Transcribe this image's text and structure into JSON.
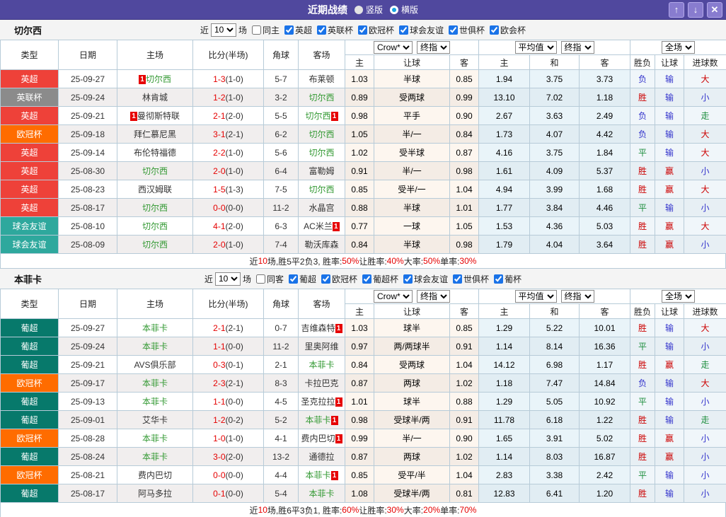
{
  "titlebar": {
    "title": "近期战绩",
    "radios": [
      {
        "label": "竖版",
        "selected": false
      },
      {
        "label": "横版",
        "selected": true
      }
    ],
    "buttons": {
      "up": "↑",
      "down": "↓",
      "close": "✕"
    }
  },
  "table_header": {
    "col_type": "类型",
    "col_date": "日期",
    "col_home": "主场",
    "col_score": "比分(半场)",
    "col_corner": "角球",
    "col_away": "客场",
    "dd_crow": "Crow*",
    "dd_final1": "终指",
    "dd_avg": "平均值",
    "dd_final2": "终指",
    "dd_full": "全场",
    "sub_crow": [
      "主",
      "让球",
      "客"
    ],
    "sub_avg": [
      "主",
      "和",
      "客"
    ],
    "sub_res": [
      "胜负",
      "让球",
      "进球数"
    ]
  },
  "colors": {
    "titlebar_bg": "#50489E",
    "titlebar_button_bg": "#887CCF",
    "checkbox_blue": "#1A73E8",
    "focus_team_green": "#339933",
    "score_red": "#E50000",
    "red_card": "#E60000"
  },
  "league_colors": {
    "英超": "#ee4139",
    "英联杯": "#8b8b8b",
    "欧冠杯": "#ff6c00",
    "球会友谊": "#2ea89d",
    "葡超": "#07796b"
  },
  "result_colors": {
    "胜": "#cc0000",
    "赢": "#cc0000",
    "大": "#cc0000",
    "平": "#1e8e3e",
    "走": "#1e8e3e",
    "负": "#3333cc",
    "输": "#3333cc",
    "小": "#3333cc"
  },
  "sections": [
    {
      "team": "切尔西",
      "filter": {
        "prefix": "近",
        "count": "10",
        "suffix": "场",
        "same": "同主",
        "leagues": [
          "英超",
          "英联杯",
          "欧冠杯",
          "球会友谊",
          "世俱杯",
          "欧会杯"
        ]
      },
      "rows": [
        {
          "league": "英超",
          "date": "25-09-27",
          "home": "切尔西",
          "home_focus": true,
          "home_red": true,
          "ft": "1-3",
          "ht": "(1-0)",
          "corners": "5-7",
          "away": "布莱顿",
          "away_focus": false,
          "away_red": false,
          "odds": [
            "1.03",
            "半球",
            "0.85"
          ],
          "avg": [
            "1.94",
            "3.75",
            "3.73"
          ],
          "res": [
            "负",
            "输",
            "大"
          ]
        },
        {
          "league": "英联杯",
          "date": "25-09-24",
          "home": "林肯城",
          "home_focus": false,
          "home_red": false,
          "ft": "1-2",
          "ht": "(1-0)",
          "corners": "3-2",
          "away": "切尔西",
          "away_focus": true,
          "away_red": false,
          "odds": [
            "0.89",
            "受两球",
            "0.99"
          ],
          "avg": [
            "13.10",
            "7.02",
            "1.18"
          ],
          "res": [
            "胜",
            "输",
            "小"
          ]
        },
        {
          "league": "英超",
          "date": "25-09-21",
          "home": "曼彻斯特联",
          "home_focus": false,
          "home_red": true,
          "ft": "2-1",
          "ht": "(2-0)",
          "corners": "5-5",
          "away": "切尔西",
          "away_focus": true,
          "away_red": true,
          "odds": [
            "0.98",
            "平手",
            "0.90"
          ],
          "avg": [
            "2.67",
            "3.63",
            "2.49"
          ],
          "res": [
            "负",
            "输",
            "走"
          ]
        },
        {
          "league": "欧冠杯",
          "date": "25-09-18",
          "home": "拜仁慕尼黑",
          "home_focus": false,
          "home_red": false,
          "ft": "3-1",
          "ht": "(2-1)",
          "corners": "6-2",
          "away": "切尔西",
          "away_focus": true,
          "away_red": false,
          "odds": [
            "1.05",
            "半/一",
            "0.84"
          ],
          "avg": [
            "1.73",
            "4.07",
            "4.42"
          ],
          "res": [
            "负",
            "输",
            "大"
          ]
        },
        {
          "league": "英超",
          "date": "25-09-14",
          "home": "布伦特福德",
          "home_focus": false,
          "home_red": false,
          "ft": "2-2",
          "ht": "(1-0)",
          "corners": "5-6",
          "away": "切尔西",
          "away_focus": true,
          "away_red": false,
          "odds": [
            "1.02",
            "受半球",
            "0.87"
          ],
          "avg": [
            "4.16",
            "3.75",
            "1.84"
          ],
          "res": [
            "平",
            "输",
            "大"
          ]
        },
        {
          "league": "英超",
          "date": "25-08-30",
          "home": "切尔西",
          "home_focus": true,
          "home_red": false,
          "ft": "2-0",
          "ht": "(1-0)",
          "corners": "6-4",
          "away": "富勒姆",
          "away_focus": false,
          "away_red": false,
          "odds": [
            "0.91",
            "半/一",
            "0.98"
          ],
          "avg": [
            "1.61",
            "4.09",
            "5.37"
          ],
          "res": [
            "胜",
            "赢",
            "小"
          ]
        },
        {
          "league": "英超",
          "date": "25-08-23",
          "home": "西汉姆联",
          "home_focus": false,
          "home_red": false,
          "ft": "1-5",
          "ht": "(1-3)",
          "corners": "7-5",
          "away": "切尔西",
          "away_focus": true,
          "away_red": false,
          "odds": [
            "0.85",
            "受半/一",
            "1.04"
          ],
          "avg": [
            "4.94",
            "3.99",
            "1.68"
          ],
          "res": [
            "胜",
            "赢",
            "大"
          ]
        },
        {
          "league": "英超",
          "date": "25-08-17",
          "home": "切尔西",
          "home_focus": true,
          "home_red": false,
          "ft": "0-0",
          "ht": "(0-0)",
          "corners": "11-2",
          "away": "水晶宫",
          "away_focus": false,
          "away_red": false,
          "odds": [
            "0.88",
            "半球",
            "1.01"
          ],
          "avg": [
            "1.77",
            "3.84",
            "4.46"
          ],
          "res": [
            "平",
            "输",
            "小"
          ]
        },
        {
          "league": "球会友谊",
          "date": "25-08-10",
          "home": "切尔西",
          "home_focus": true,
          "home_red": false,
          "ft": "4-1",
          "ht": "(2-0)",
          "corners": "6-3",
          "away": "AC米兰",
          "away_focus": false,
          "away_red": true,
          "odds": [
            "0.77",
            "一球",
            "1.05"
          ],
          "avg": [
            "1.53",
            "4.36",
            "5.03"
          ],
          "res": [
            "胜",
            "赢",
            "大"
          ]
        },
        {
          "league": "球会友谊",
          "date": "25-08-09",
          "home": "切尔西",
          "home_focus": true,
          "home_red": false,
          "ft": "2-0",
          "ht": "(1-0)",
          "corners": "7-4",
          "away": "勒沃库森",
          "away_focus": false,
          "away_red": false,
          "odds": [
            "0.84",
            "半球",
            "0.98"
          ],
          "avg": [
            "1.79",
            "4.04",
            "3.64"
          ],
          "res": [
            "胜",
            "赢",
            "小"
          ]
        }
      ],
      "summary": [
        {
          "text": "近",
          "red": false
        },
        {
          "text": "10",
          "red": true
        },
        {
          "text": "场,胜5平2负3, 胜率:",
          "red": false
        },
        {
          "text": "50%",
          "red": true
        },
        {
          "text": " 让胜率:",
          "red": false
        },
        {
          "text": "40%",
          "red": true
        },
        {
          "text": " 大率:",
          "red": false
        },
        {
          "text": "50%",
          "red": true
        },
        {
          "text": " 单率:",
          "red": false
        },
        {
          "text": "30%",
          "red": true
        }
      ]
    },
    {
      "team": "本菲卡",
      "filter": {
        "prefix": "近",
        "count": "10",
        "suffix": "场",
        "same": "同客",
        "leagues": [
          "葡超",
          "欧冠杯",
          "葡超杯",
          "球会友谊",
          "世俱杯",
          "葡杯"
        ]
      },
      "rows": [
        {
          "league": "葡超",
          "date": "25-09-27",
          "home": "本菲卡",
          "home_focus": true,
          "home_red": false,
          "ft": "2-1",
          "ht": "(2-1)",
          "corners": "0-7",
          "away": "吉维森特",
          "away_focus": false,
          "away_red": true,
          "odds": [
            "1.03",
            "球半",
            "0.85"
          ],
          "avg": [
            "1.29",
            "5.22",
            "10.01"
          ],
          "res": [
            "胜",
            "输",
            "大"
          ]
        },
        {
          "league": "葡超",
          "date": "25-09-24",
          "home": "本菲卡",
          "home_focus": true,
          "home_red": false,
          "ft": "1-1",
          "ht": "(0-0)",
          "corners": "11-2",
          "away": "里奥阿维",
          "away_focus": false,
          "away_red": false,
          "odds": [
            "0.97",
            "两/两球半",
            "0.91"
          ],
          "avg": [
            "1.14",
            "8.14",
            "16.36"
          ],
          "res": [
            "平",
            "输",
            "小"
          ]
        },
        {
          "league": "葡超",
          "date": "25-09-21",
          "home": "AVS俱乐部",
          "home_focus": false,
          "home_red": false,
          "ft": "0-3",
          "ht": "(0-1)",
          "corners": "2-1",
          "away": "本菲卡",
          "away_focus": true,
          "away_red": false,
          "odds": [
            "0.84",
            "受两球",
            "1.04"
          ],
          "avg": [
            "14.12",
            "6.98",
            "1.17"
          ],
          "res": [
            "胜",
            "赢",
            "走"
          ]
        },
        {
          "league": "欧冠杯",
          "date": "25-09-17",
          "home": "本菲卡",
          "home_focus": true,
          "home_red": false,
          "ft": "2-3",
          "ht": "(2-1)",
          "corners": "8-3",
          "away": "卡拉巴克",
          "away_focus": false,
          "away_red": false,
          "odds": [
            "0.87",
            "两球",
            "1.02"
          ],
          "avg": [
            "1.18",
            "7.47",
            "14.84"
          ],
          "res": [
            "负",
            "输",
            "大"
          ]
        },
        {
          "league": "葡超",
          "date": "25-09-13",
          "home": "本菲卡",
          "home_focus": true,
          "home_red": false,
          "ft": "1-1",
          "ht": "(0-0)",
          "corners": "4-5",
          "away": "圣克拉拉",
          "away_focus": false,
          "away_red": true,
          "odds": [
            "1.01",
            "球半",
            "0.88"
          ],
          "avg": [
            "1.29",
            "5.05",
            "10.92"
          ],
          "res": [
            "平",
            "输",
            "小"
          ]
        },
        {
          "league": "葡超",
          "date": "25-09-01",
          "home": "艾华卡",
          "home_focus": false,
          "home_red": false,
          "ft": "1-2",
          "ht": "(0-2)",
          "corners": "5-2",
          "away": "本菲卡",
          "away_focus": true,
          "away_red": true,
          "odds": [
            "0.98",
            "受球半/两",
            "0.91"
          ],
          "avg": [
            "11.78",
            "6.18",
            "1.22"
          ],
          "res": [
            "胜",
            "输",
            "走"
          ]
        },
        {
          "league": "欧冠杯",
          "date": "25-08-28",
          "home": "本菲卡",
          "home_focus": true,
          "home_red": false,
          "ft": "1-0",
          "ht": "(1-0)",
          "corners": "4-1",
          "away": "费内巴切",
          "away_focus": false,
          "away_red": true,
          "odds": [
            "0.99",
            "半/一",
            "0.90"
          ],
          "avg": [
            "1.65",
            "3.91",
            "5.02"
          ],
          "res": [
            "胜",
            "赢",
            "小"
          ]
        },
        {
          "league": "葡超",
          "date": "25-08-24",
          "home": "本菲卡",
          "home_focus": true,
          "home_red": false,
          "ft": "3-0",
          "ht": "(2-0)",
          "corners": "13-2",
          "away": "通德拉",
          "away_focus": false,
          "away_red": false,
          "odds": [
            "0.87",
            "两球",
            "1.02"
          ],
          "avg": [
            "1.14",
            "8.03",
            "16.87"
          ],
          "res": [
            "胜",
            "赢",
            "小"
          ]
        },
        {
          "league": "欧冠杯",
          "date": "25-08-21",
          "home": "费内巴切",
          "home_focus": false,
          "home_red": false,
          "ft": "0-0",
          "ht": "(0-0)",
          "corners": "4-4",
          "away": "本菲卡",
          "away_focus": true,
          "away_red": true,
          "odds": [
            "0.85",
            "受平/半",
            "1.04"
          ],
          "avg": [
            "2.83",
            "3.38",
            "2.42"
          ],
          "res": [
            "平",
            "输",
            "小"
          ]
        },
        {
          "league": "葡超",
          "date": "25-08-17",
          "home": "阿马多拉",
          "home_focus": false,
          "home_red": false,
          "ft": "0-1",
          "ht": "(0-0)",
          "corners": "5-4",
          "away": "本菲卡",
          "away_focus": true,
          "away_red": false,
          "odds": [
            "1.08",
            "受球半/两",
            "0.81"
          ],
          "avg": [
            "12.83",
            "6.41",
            "1.20"
          ],
          "res": [
            "胜",
            "输",
            "小"
          ]
        }
      ],
      "summary": [
        {
          "text": "近",
          "red": false
        },
        {
          "text": "10",
          "red": true
        },
        {
          "text": "场,胜6平3负1, 胜率:",
          "red": false
        },
        {
          "text": "60%",
          "red": true
        },
        {
          "text": " 让胜率:",
          "red": false
        },
        {
          "text": "30%",
          "red": true
        },
        {
          "text": " 大率:",
          "red": false
        },
        {
          "text": "20%",
          "red": true
        },
        {
          "text": " 单率:",
          "red": false
        },
        {
          "text": "70%",
          "red": true
        }
      ]
    }
  ]
}
